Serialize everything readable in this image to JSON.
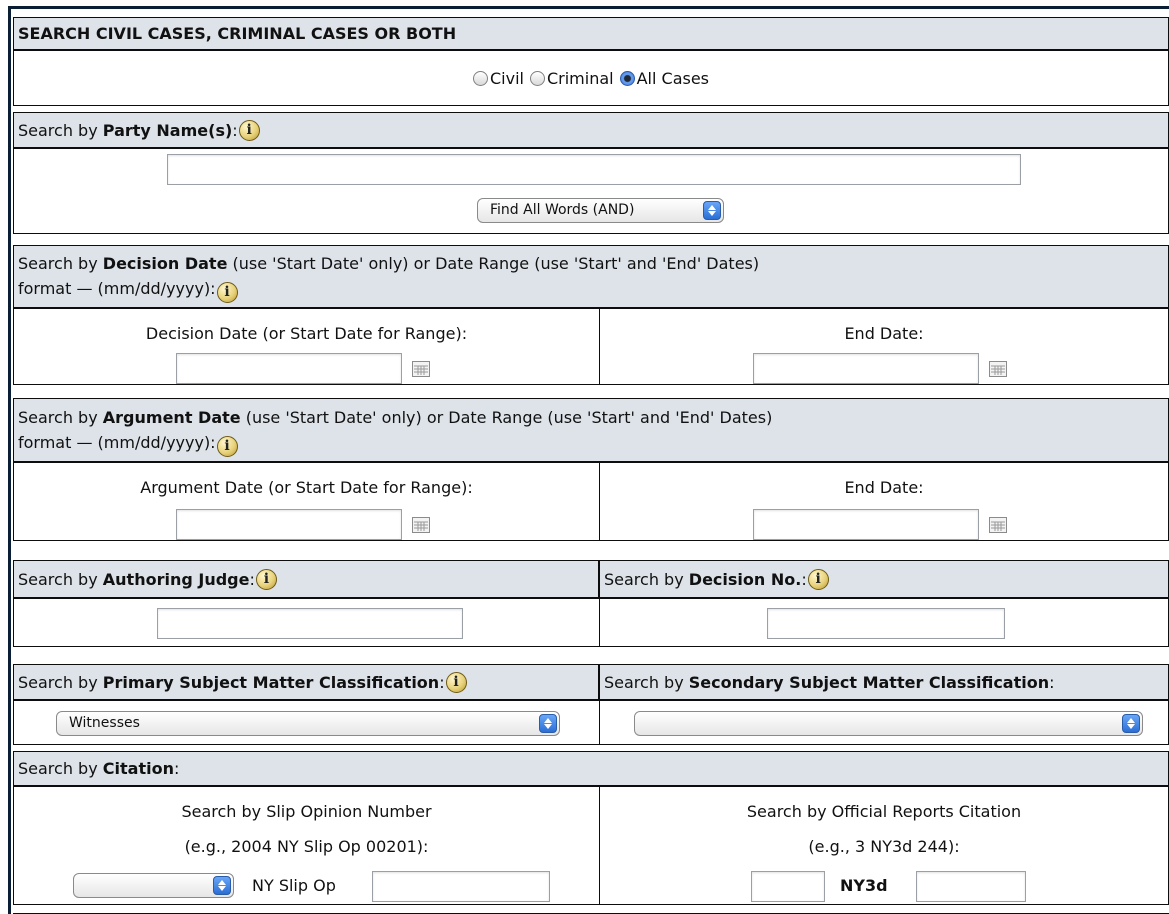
{
  "search_type": {
    "header": "SEARCH CIVIL CASES, CRIMINAL CASES OR BOTH",
    "options": [
      {
        "label": "Civil",
        "selected": false
      },
      {
        "label": "Criminal",
        "selected": false
      },
      {
        "label": "All Cases",
        "selected": true
      }
    ]
  },
  "party_name": {
    "prefix": "Search by",
    "title": "Party Name(s)",
    "value": "",
    "mode_select": "Find All Words (AND)"
  },
  "decision_date": {
    "prefix": "Search by",
    "title": "Decision Date",
    "desc": "(use 'Start Date' only) or Date Range (use 'Start' and 'End' Dates)",
    "format": "format — (mm/dd/yyyy):",
    "start_label": "Decision Date (or Start Date for Range):",
    "end_label": "End Date:",
    "start_value": "",
    "end_value": ""
  },
  "argument_date": {
    "prefix": "Search by",
    "title": "Argument Date",
    "desc": "(use 'Start Date' only) or Date Range (use 'Start' and 'End' Dates)",
    "format": "format — (mm/dd/yyyy):",
    "start_label": "Argument Date (or Start Date for Range):",
    "end_label": "End Date:",
    "start_value": "",
    "end_value": ""
  },
  "judge": {
    "prefix": "Search by",
    "title": "Authoring Judge",
    "value": ""
  },
  "decision_no": {
    "prefix": "Search by",
    "title": "Decision No.",
    "value": ""
  },
  "primary_subject": {
    "prefix": "Search by",
    "title": "Primary Subject Matter Classification",
    "selected": "Witnesses"
  },
  "secondary_subject": {
    "prefix": "Search by",
    "title": "Secondary Subject Matter Classification",
    "selected": ""
  },
  "citation": {
    "prefix": "Search by",
    "title": "Citation",
    "slip_label": "Search by Slip Opinion Number",
    "slip_example": "(e.g., 2004 NY Slip Op 00201):",
    "slip_suffix": "NY Slip Op",
    "slip_year": "",
    "slip_number": "",
    "official_label": "Search by Official Reports Citation",
    "official_example": "(e.g., 3 NY3d 244):",
    "official_reporter": "NY3d",
    "official_volume": "",
    "official_page": ""
  },
  "icons": {
    "info": "info-icon",
    "calendar": "calendar-icon"
  }
}
